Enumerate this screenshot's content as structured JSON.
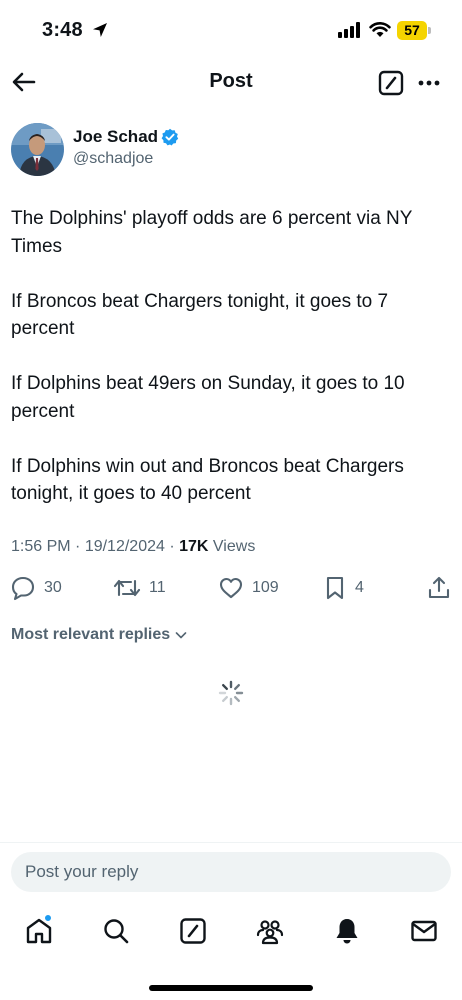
{
  "status_bar": {
    "time": "3:48",
    "battery": "57",
    "icons": [
      "location-arrow-icon",
      "signal-icon",
      "wifi-icon",
      "battery-icon"
    ]
  },
  "header": {
    "title": "Post",
    "icons": [
      "back-arrow-icon",
      "grok-icon",
      "more-icon"
    ]
  },
  "author": {
    "name": "Joe Schad",
    "handle": "@schadjoe",
    "verified": true
  },
  "tweet": {
    "paragraphs": [
      "The Dolphins' playoff odds are 6 percent via NY Times",
      "If Broncos beat Chargers tonight, it goes to 7 percent",
      "If Dolphins beat 49ers on Sunday, it goes to 10 percent",
      "If Dolphins win out and Broncos beat Chargers tonight, it goes to 40 percent"
    ],
    "time": "1:56 PM",
    "date": "19/12/2024",
    "views_count": "17K",
    "views_label": "Views"
  },
  "actions": {
    "replies": "30",
    "reposts": "11",
    "likes": "109",
    "bookmarks": "4"
  },
  "replies": {
    "sort_label": "Most relevant replies"
  },
  "compose": {
    "placeholder": "Post your reply"
  },
  "tabbar": {
    "items": [
      "home",
      "search",
      "grok",
      "communities",
      "notifications",
      "messages"
    ]
  },
  "colors": {
    "accent": "#1d9bf0",
    "text": "#0f1419",
    "secondary": "#536471",
    "battery": "#f5d400"
  }
}
